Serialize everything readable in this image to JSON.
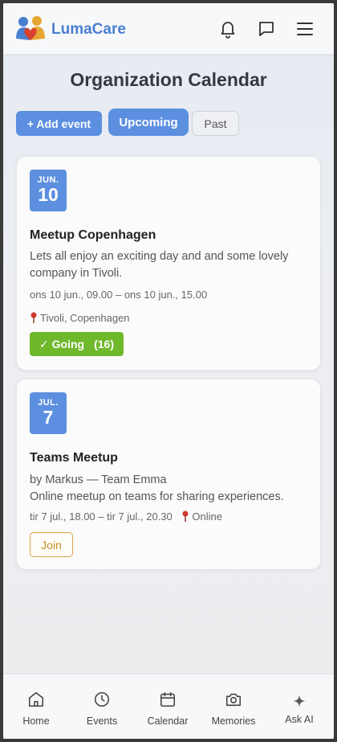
{
  "app": {
    "brand": "LumaCare"
  },
  "page": {
    "title": "Organization Calendar"
  },
  "toolbar": {
    "add_label": "+ Add event",
    "upcoming_label": "Upcoming",
    "past_label": "Past"
  },
  "events": [
    {
      "month": "JUN.",
      "day": "10",
      "title": "Meetup Copenhagen",
      "description": "Lets all enjoy an exciting day and and some lovely company in Tivoli.",
      "time": "ons 10 jun., 09.00 – ons 10 jun., 15.00",
      "location": "Tivoli, Copenhagen",
      "going_label": "✓ Going",
      "going_count": "(16)"
    },
    {
      "month": "JUL.",
      "day": "7",
      "title": "Teams Meetup",
      "organizer": "by Markus — Team Emma",
      "description": "Online meetup on teams for sharing experiences.",
      "time": "tir 7 jul., 18.00 – tir 7 jul., 20.30",
      "location": "Online",
      "join_label": "Join"
    }
  ],
  "nav": [
    {
      "label": "Home",
      "icon": "home-icon"
    },
    {
      "label": "Events",
      "icon": "clock-icon"
    },
    {
      "label": "Calendar",
      "icon": "calendar-icon"
    },
    {
      "label": "Memories",
      "icon": "camera-icon"
    },
    {
      "label": "Ask AI",
      "icon": "sparkle-icon"
    }
  ],
  "colors": {
    "accent": "#5c8fdf",
    "going": "#6fb82c",
    "join": "#d9a445",
    "brand": "#4a7fd0"
  }
}
